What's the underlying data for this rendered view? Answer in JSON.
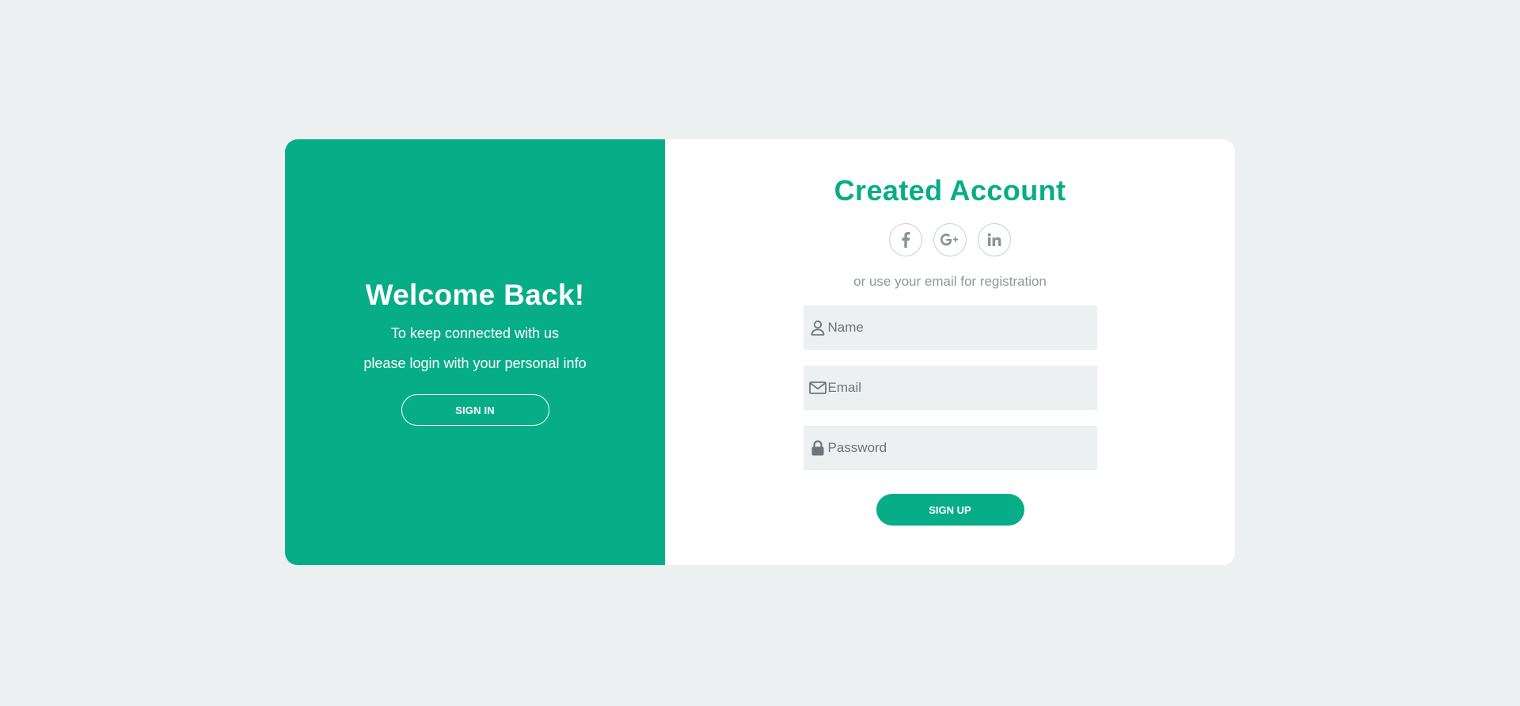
{
  "left": {
    "title": "Welcome Back!",
    "line1": "To keep connected with us",
    "line2": "please login with your personal info",
    "signin_label": "SIGN IN"
  },
  "right": {
    "title": "Created Account",
    "social": [
      {
        "icon": "facebook-icon",
        "glyph": "f"
      },
      {
        "icon": "google-plus-icon",
        "glyph": "G+"
      },
      {
        "icon": "linkedin-icon",
        "glyph": "in"
      }
    ],
    "hint": "or use your email for registration",
    "fields": {
      "name_placeholder": "Name",
      "email_placeholder": "Email",
      "password_placeholder": "Password"
    },
    "signup_label": "SIGN UP"
  },
  "colors": {
    "accent": "#07ad87",
    "background": "#ecf0f1",
    "input_bg": "#ecf0f1"
  }
}
